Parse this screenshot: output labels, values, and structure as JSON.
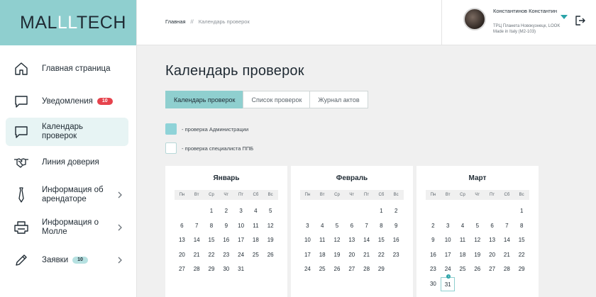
{
  "logo": {
    "part1": "MAL",
    "part2": "LL",
    "part3": "TECH"
  },
  "sidebar": {
    "items": [
      {
        "label": "Главная страница",
        "icon": "home-icon"
      },
      {
        "label": "Уведомления",
        "icon": "chat-icon",
        "badge": "10"
      },
      {
        "label": "Календарь проверок",
        "icon": "chat-icon"
      },
      {
        "label": "Линия доверия",
        "icon": "handshake-icon"
      },
      {
        "label": "Информация об арендаторе",
        "icon": "tie-icon"
      },
      {
        "label": "Информация о Молле",
        "icon": "printer-icon"
      },
      {
        "label": "Заявки",
        "icon": "pen-icon",
        "badge": "10"
      }
    ]
  },
  "breadcrumb": {
    "home": "Главная",
    "sep": "//",
    "current": "Календарь проверок"
  },
  "user": {
    "name": "Константинов Константин",
    "location": "ТРЦ Планета Новокузнецк, LOOK Made in Italy (М2-103)"
  },
  "page": {
    "title": "Календарь проверок"
  },
  "tabs": [
    "Календарь проверок",
    "Список проверок",
    "Журнал актов"
  ],
  "legend": {
    "admin": "- проверка Администрации",
    "ppb": "- проверка специалиста ППБ"
  },
  "colors": {
    "accent": "#8fcfcf",
    "teal": "#2aa3a8",
    "badge_red": "#e6434d"
  },
  "weekdays": [
    "Пн",
    "Вт",
    "Ср",
    "Чт",
    "Пт",
    "Сб",
    "Вс"
  ],
  "months": [
    {
      "name": "Январь",
      "offset": 2,
      "days": 31
    },
    {
      "name": "Февраль",
      "offset": 5,
      "days": 29
    },
    {
      "name": "Март",
      "offset": 6,
      "days": 31,
      "today": 31,
      "today_count": "1"
    }
  ]
}
